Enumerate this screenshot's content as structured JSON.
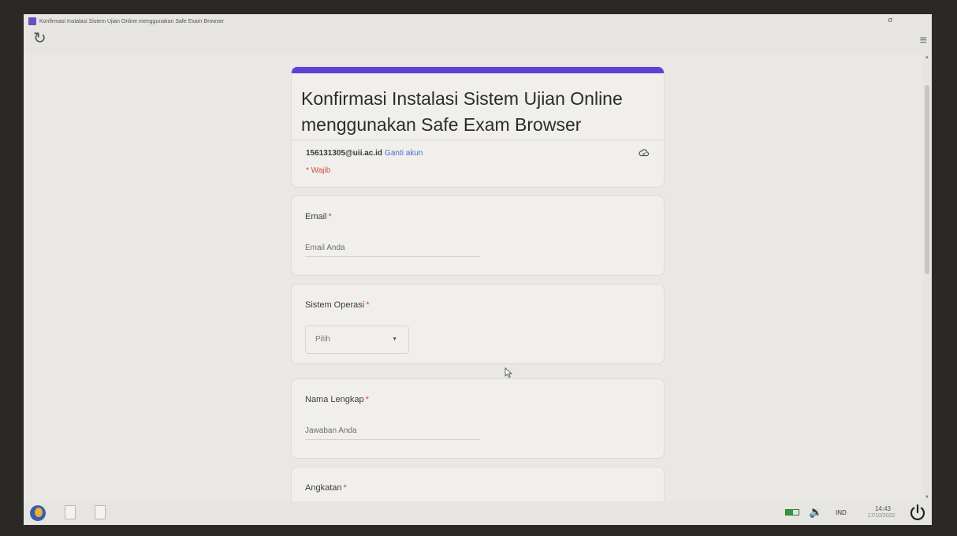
{
  "window": {
    "title": "Konfirmasi Instalasi Sistem Ujian Online menggunakan Safe Exam Browser",
    "restore_glyph": "σ",
    "reload_glyph": "↻",
    "menu_glyph": "≡"
  },
  "form": {
    "title": "Konfirmasi Instalasi Sistem Ujian Online menggunakan Safe Exam Browser",
    "account_email": "156131305@uii.ac.id",
    "switch_account": "Ganti akun",
    "required_note": "* Wajib",
    "accent_color": "#5f3fd8",
    "questions": [
      {
        "label": "Email",
        "required_mark": "*",
        "placeholder": "Email Anda"
      },
      {
        "label": "Sistem Operasi",
        "required_mark": "*",
        "select_value": "Pilih"
      },
      {
        "label": "Nama Lengkap",
        "required_mark": "*",
        "placeholder": "Jawaban Anda"
      },
      {
        "label": "Angkatan",
        "required_mark": "*"
      }
    ]
  },
  "icons": {
    "cloud": "cloud-icon",
    "cursor": "cursor-icon",
    "feedback": "feedback-icon",
    "edit": "pencil-icon",
    "power": "power-icon"
  },
  "taskbar": {
    "language": "IND",
    "time": "14:43",
    "date": "17/10/2022",
    "volume_glyph": "🔉"
  }
}
